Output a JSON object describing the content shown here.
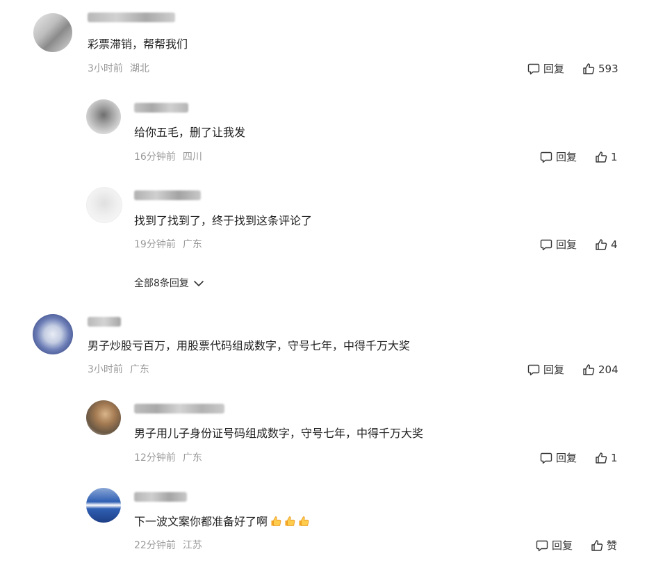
{
  "colors": {
    "text": "#222222",
    "meta": "#999999",
    "action": "#333333"
  },
  "icons": {
    "reply": "comment-bubble-icon",
    "like": "thumbs-up-icon",
    "expand": "chevron-down-icon",
    "emoji": "thumbs-up-emoji"
  },
  "comments": [
    {
      "text": "彩票滞销，帮帮我们",
      "time": "3小时前",
      "region": "湖北",
      "reply_label": "回复",
      "likes": "593",
      "replies": [
        {
          "text": "给你五毛，删了让我发",
          "time": "16分钟前",
          "region": "四川",
          "reply_label": "回复",
          "likes": "1"
        },
        {
          "text": "找到了找到了，终于找到这条评论了",
          "time": "19分钟前",
          "region": "广东",
          "reply_label": "回复",
          "likes": "4"
        }
      ],
      "expand_label": "全部8条回复"
    },
    {
      "text": "男子炒股亏百万，用股票代码组成数字，守号七年，中得千万大奖",
      "time": "3小时前",
      "region": "广东",
      "reply_label": "回复",
      "likes": "204",
      "replies": [
        {
          "text": "男子用儿子身份证号码组成数字，守号七年，中得千万大奖",
          "time": "12分钟前",
          "region": "广东",
          "reply_label": "回复",
          "likes": "1"
        },
        {
          "text": "下一波文案你都准备好了啊",
          "time": "22分钟前",
          "region": "江苏",
          "reply_label": "回复",
          "likes": "赞"
        }
      ]
    }
  ]
}
